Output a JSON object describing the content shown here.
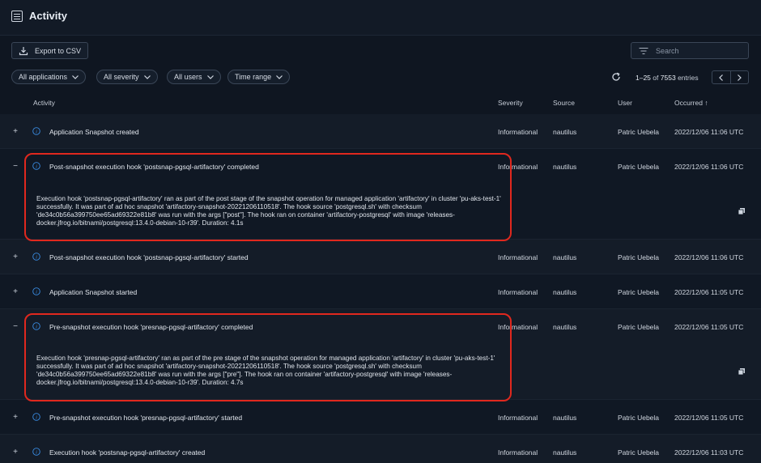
{
  "header": {
    "title": "Activity"
  },
  "toolbar": {
    "export_label": "Export to CSV",
    "search_placeholder": "Search"
  },
  "filters": [
    "All applications",
    "All severity",
    "All users",
    "Time range"
  ],
  "pagination": {
    "range": "1–25",
    "of_label": "of",
    "total": "7553",
    "suffix": "entries"
  },
  "columns": {
    "activity": "Activity",
    "severity": "Severity",
    "source": "Source",
    "user": "User",
    "occurred": "Occurred ↑"
  },
  "rows": [
    {
      "toggle": "+",
      "activity": "Application Snapshot created",
      "severity": "Informational",
      "source": "nautilus",
      "user": "Patric Uebela",
      "occurred": "2022/12/06 11:06 UTC"
    },
    {
      "toggle": "−",
      "activity": "Post-snapshot execution hook 'postsnap-pgsql-artifactory' completed",
      "severity": "Informational",
      "source": "nautilus",
      "user": "Patric Uebela",
      "occurred": "2022/12/06 11:06 UTC",
      "detail": "Execution hook 'postsnap-pgsql-artifactory' ran as part of the post stage of the snapshot operation for managed application 'artifactory' in cluster 'pu-aks-test-1' successfully. It was part of ad hoc snapshot 'artifactory-snapshot-20221206110518'. The hook source 'postgresql.sh' with checksum 'de34c0b56a399750ee65ad69322e81b8' was run with the args [\"post\"]. The hook ran on container 'artifactory-postgresql' with image 'releases-docker.jfrog.io/bitnami/postgresql:13.4.0-debian-10-r39'. Duration: 4.1s"
    },
    {
      "toggle": "+",
      "activity": "Post-snapshot execution hook 'postsnap-pgsql-artifactory' started",
      "severity": "Informational",
      "source": "nautilus",
      "user": "Patric Uebela",
      "occurred": "2022/12/06 11:06 UTC"
    },
    {
      "toggle": "+",
      "activity": "Application Snapshot started",
      "severity": "Informational",
      "source": "nautilus",
      "user": "Patric Uebela",
      "occurred": "2022/12/06 11:05 UTC"
    },
    {
      "toggle": "−",
      "activity": "Pre-snapshot execution hook 'presnap-pgsql-artifactory' completed",
      "severity": "Informational",
      "source": "nautilus",
      "user": "Patric Uebela",
      "occurred": "2022/12/06 11:05 UTC",
      "detail": "Execution hook 'presnap-pgsql-artifactory' ran as part of the pre stage of the snapshot operation for managed application 'artifactory' in cluster 'pu-aks-test-1' successfully. It was part of ad hoc snapshot 'artifactory-snapshot-20221206110518'. The hook source 'postgresql.sh' with checksum 'de34c0b56a399750ee65ad69322e81b8' was run with the args [\"pre\"]. The hook ran on container 'artifactory-postgresql' with image 'releases-docker.jfrog.io/bitnami/postgresql:13.4.0-debian-10-r39'. Duration: 4.7s"
    },
    {
      "toggle": "+",
      "activity": "Pre-snapshot execution hook 'presnap-pgsql-artifactory' started",
      "severity": "Informational",
      "source": "nautilus",
      "user": "Patric Uebela",
      "occurred": "2022/12/06 11:05 UTC"
    },
    {
      "toggle": "+",
      "activity": "Execution hook 'postsnap-pgsql-artifactory' created",
      "severity": "Informational",
      "source": "nautilus",
      "user": "Patric Uebela",
      "occurred": "2022/12/06 11:03 UTC"
    }
  ],
  "colors": {
    "background": "#0f1621",
    "accent_info": "#3a8ee6",
    "highlight": "#e0281e"
  },
  "icons": {
    "menu": "menu-list-icon",
    "export": "download-icon",
    "search": "filter-lines-icon",
    "refresh": "refresh-icon",
    "info": "info-circle-icon",
    "copy": "copy-icon"
  }
}
